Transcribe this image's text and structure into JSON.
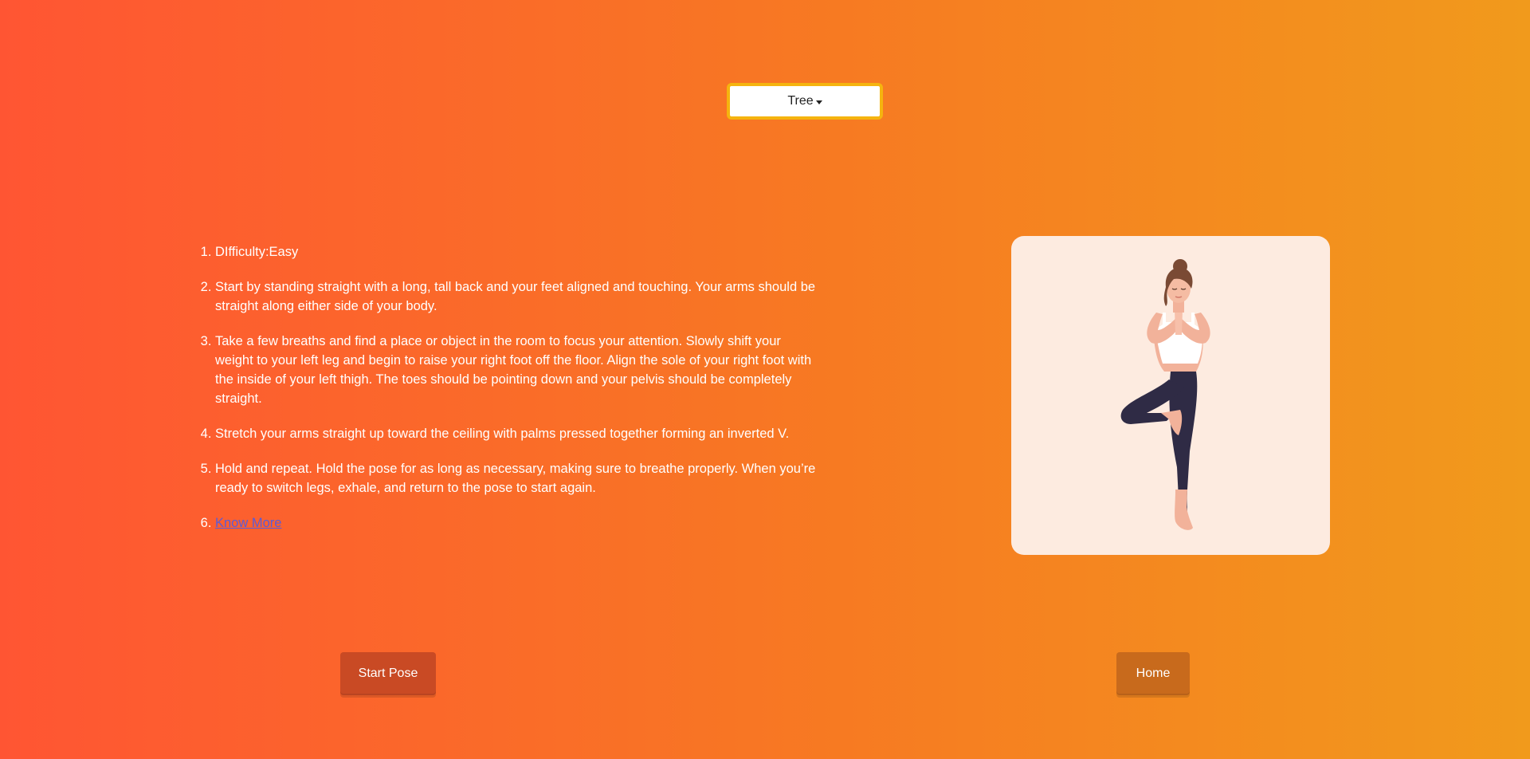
{
  "pose_selector": {
    "selected": "Tree",
    "icon": "caret-down-icon"
  },
  "instructions": [
    "DIfficulty:Easy",
    "Start by standing straight with a long, tall back and your feet aligned and touching. Your arms should be straight along either side of your body.",
    "Take a few breaths and find a place or object in the room to focus your attention. Slowly shift your weight to your left leg and begin to raise your right foot off the floor. Align the sole of your right foot with the inside of your left thigh. The toes should be pointing down and your pelvis should be completely straight.",
    "Stretch your arms straight up toward the ceiling with palms pressed together forming an inverted V.",
    "Hold and repeat. Hold the pose for as long as necessary, making sure to breathe properly. When you’re ready to switch legs, exhale, and return to the pose to start again."
  ],
  "know_more": "Know More",
  "buttons": {
    "start": "Start Pose",
    "home": "Home"
  },
  "colors": {
    "gradient_start": "#ff5533",
    "gradient_end": "#f19a1c",
    "dropdown_border": "#f5b40f",
    "card_bg": "#fdebe0",
    "start_button": "#c94a24",
    "home_button": "#c86a1c",
    "link": "#5b5bd6"
  }
}
